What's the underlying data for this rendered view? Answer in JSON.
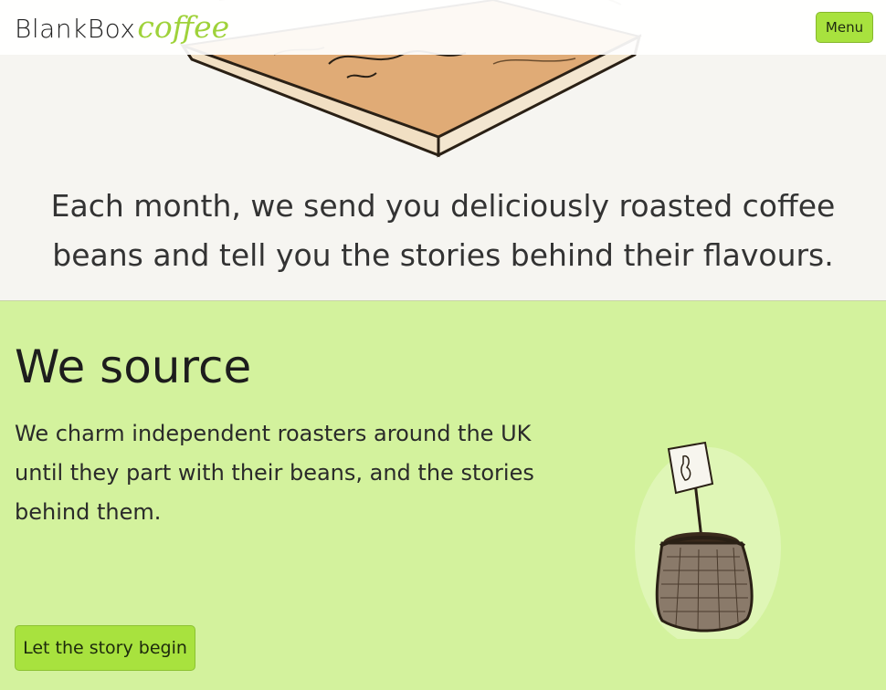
{
  "header": {
    "logo_brand": "BlankBox",
    "logo_coffee": "coffee",
    "menu_label": "Menu"
  },
  "hero": {
    "tagline": "Each month, we send you deliciously roasted coffee beans and tell you the stories behind their flavours."
  },
  "source_section": {
    "title": "We source",
    "text": "We charm independent roasters around the UK until they part with their beans, and the stories behind them.",
    "cta_label": "Let the story begin"
  },
  "colors": {
    "accent_green": "#a8e23e",
    "section_green": "#d3f29d",
    "logo_green": "#9fd23a",
    "hero_bg": "#f6f5f1"
  },
  "icons": {
    "hero_illustration": "coffee-box-illustration-icon",
    "sack_illustration": "coffee-sack-illustration-icon"
  }
}
